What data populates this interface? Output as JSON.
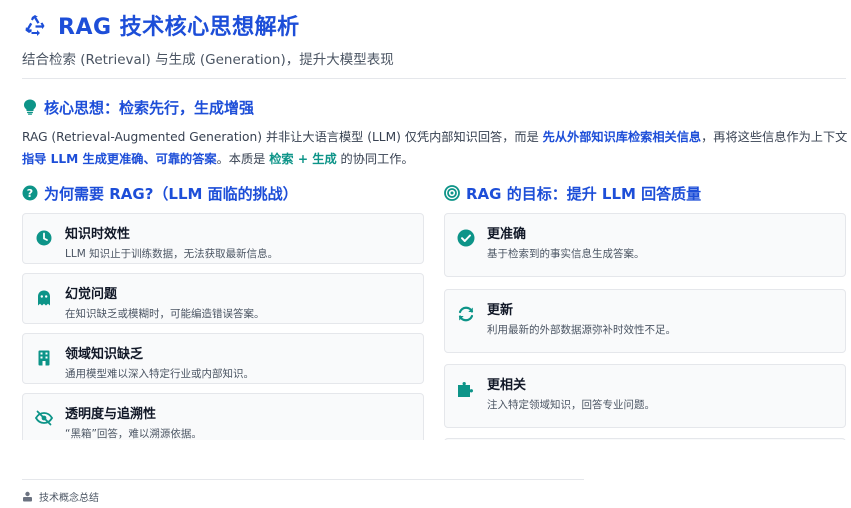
{
  "header": {
    "title": "RAG 技术核心思想解析",
    "subtitle": "结合检索 (Retrieval) 与生成 (Generation)，提升大模型表现"
  },
  "core": {
    "heading": "核心思想：检索先行，生成增强",
    "text_1": "RAG (Retrieval-Augmented Generation) 并非让大语言模型 (LLM) 仅凭内部知识回答，而是 ",
    "hl_1": "先从外部知识库检索相关信息",
    "text_2": "，再将这些信息作为上下文 ",
    "hl_2": "指导 LLM 生成更准确、可靠的答案",
    "text_3": "。本质是 ",
    "hl_3": "检索 + 生成",
    "text_4": " 的协同工作。"
  },
  "left": {
    "heading": "为何需要 RAG?（LLM 面临的挑战）",
    "cards": [
      {
        "title": "知识时效性",
        "desc": "LLM 知识止于训练数据，无法获取最新信息。",
        "icon": "clock-icon"
      },
      {
        "title": "幻觉问题",
        "desc": "在知识缺乏或模糊时，可能编造错误答案。",
        "icon": "ghost-icon"
      },
      {
        "title": "领域知识缺乏",
        "desc": "通用模型难以深入特定行业或内部知识。",
        "icon": "building-icon"
      },
      {
        "title": "透明度与追溯性",
        "desc": "“黑箱”回答，难以溯源依据。",
        "icon": "eye-slash-icon"
      }
    ]
  },
  "right": {
    "heading": "RAG 的目标：提升 LLM 回答质量",
    "cards": [
      {
        "title": "更准确",
        "desc": "基于检索到的事实信息生成答案。",
        "icon": "check-circle-icon"
      },
      {
        "title": "更新",
        "desc": "利用最新的外部数据源弥补时效性不足。",
        "icon": "refresh-icon"
      },
      {
        "title": "更相关",
        "desc": "注入特定领域知识，回答专业问题。",
        "icon": "puzzle-icon"
      }
    ]
  },
  "footer": {
    "label": "技术概念总结"
  },
  "colors": {
    "primary_blue": "#1d4ed8",
    "teal": "#0d9488",
    "text": "#374151"
  }
}
